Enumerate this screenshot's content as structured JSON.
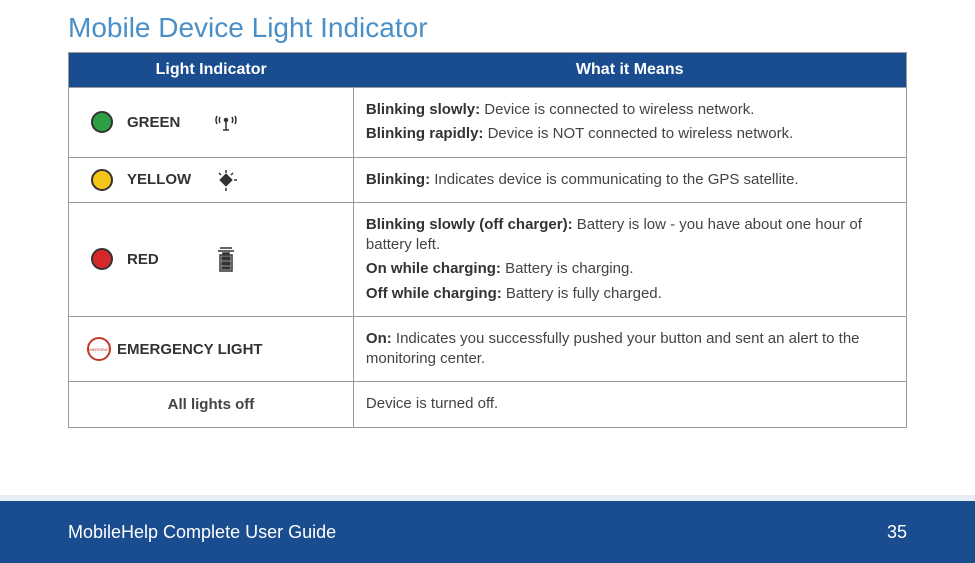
{
  "title": "Mobile Device Light Indicator",
  "headers": {
    "col1": "Light Indicator",
    "col2": "What it Means"
  },
  "rows": {
    "green": {
      "label": "GREEN",
      "m1_lead": "Blinking slowly:",
      "m1_text": " Device is connected to wireless network.",
      "m2_lead": "Blinking rapidly:",
      "m2_text": " Device is NOT connected to wireless network."
    },
    "yellow": {
      "label": "YELLOW",
      "m1_lead": "Blinking:",
      "m1_text": " Indicates device is communicating to the GPS satellite."
    },
    "red": {
      "label": "RED",
      "m1_lead": "Blinking slowly (off charger):",
      "m1_text": " Battery is low - you have about one hour of battery left.",
      "m2_lead": "On while charging:",
      "m2_text": " Battery is charging.",
      "m3_lead": "Off while charging:",
      "m3_text": " Battery is fully charged."
    },
    "emergency": {
      "label": "EMERGENCY LIGHT",
      "badge": "EMERGENCY",
      "m1_lead": "On:",
      "m1_text": " Indicates you successfully pushed your button and sent an alert to the monitoring center."
    },
    "off": {
      "label": "All lights off",
      "m1_text": "Device is turned off."
    }
  },
  "footer": {
    "guide": "MobileHelp Complete User Guide",
    "page": "35"
  }
}
